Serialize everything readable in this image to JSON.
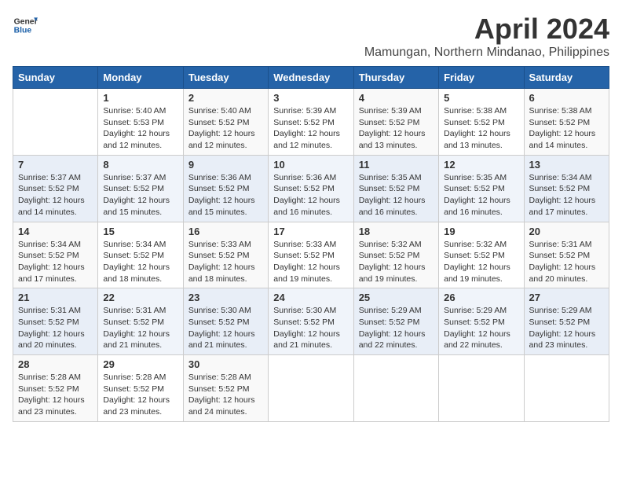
{
  "header": {
    "logo_line1": "General",
    "logo_line2": "Blue",
    "month_year": "April 2024",
    "location": "Mamungan, Northern Mindanao, Philippines"
  },
  "weekdays": [
    "Sunday",
    "Monday",
    "Tuesday",
    "Wednesday",
    "Thursday",
    "Friday",
    "Saturday"
  ],
  "weeks": [
    [
      {
        "day": "",
        "info": ""
      },
      {
        "day": "1",
        "info": "Sunrise: 5:40 AM\nSunset: 5:53 PM\nDaylight: 12 hours\nand 12 minutes."
      },
      {
        "day": "2",
        "info": "Sunrise: 5:40 AM\nSunset: 5:52 PM\nDaylight: 12 hours\nand 12 minutes."
      },
      {
        "day": "3",
        "info": "Sunrise: 5:39 AM\nSunset: 5:52 PM\nDaylight: 12 hours\nand 12 minutes."
      },
      {
        "day": "4",
        "info": "Sunrise: 5:39 AM\nSunset: 5:52 PM\nDaylight: 12 hours\nand 13 minutes."
      },
      {
        "day": "5",
        "info": "Sunrise: 5:38 AM\nSunset: 5:52 PM\nDaylight: 12 hours\nand 13 minutes."
      },
      {
        "day": "6",
        "info": "Sunrise: 5:38 AM\nSunset: 5:52 PM\nDaylight: 12 hours\nand 14 minutes."
      }
    ],
    [
      {
        "day": "7",
        "info": "Sunrise: 5:37 AM\nSunset: 5:52 PM\nDaylight: 12 hours\nand 14 minutes."
      },
      {
        "day": "8",
        "info": "Sunrise: 5:37 AM\nSunset: 5:52 PM\nDaylight: 12 hours\nand 15 minutes."
      },
      {
        "day": "9",
        "info": "Sunrise: 5:36 AM\nSunset: 5:52 PM\nDaylight: 12 hours\nand 15 minutes."
      },
      {
        "day": "10",
        "info": "Sunrise: 5:36 AM\nSunset: 5:52 PM\nDaylight: 12 hours\nand 16 minutes."
      },
      {
        "day": "11",
        "info": "Sunrise: 5:35 AM\nSunset: 5:52 PM\nDaylight: 12 hours\nand 16 minutes."
      },
      {
        "day": "12",
        "info": "Sunrise: 5:35 AM\nSunset: 5:52 PM\nDaylight: 12 hours\nand 16 minutes."
      },
      {
        "day": "13",
        "info": "Sunrise: 5:34 AM\nSunset: 5:52 PM\nDaylight: 12 hours\nand 17 minutes."
      }
    ],
    [
      {
        "day": "14",
        "info": "Sunrise: 5:34 AM\nSunset: 5:52 PM\nDaylight: 12 hours\nand 17 minutes."
      },
      {
        "day": "15",
        "info": "Sunrise: 5:34 AM\nSunset: 5:52 PM\nDaylight: 12 hours\nand 18 minutes."
      },
      {
        "day": "16",
        "info": "Sunrise: 5:33 AM\nSunset: 5:52 PM\nDaylight: 12 hours\nand 18 minutes."
      },
      {
        "day": "17",
        "info": "Sunrise: 5:33 AM\nSunset: 5:52 PM\nDaylight: 12 hours\nand 19 minutes."
      },
      {
        "day": "18",
        "info": "Sunrise: 5:32 AM\nSunset: 5:52 PM\nDaylight: 12 hours\nand 19 minutes."
      },
      {
        "day": "19",
        "info": "Sunrise: 5:32 AM\nSunset: 5:52 PM\nDaylight: 12 hours\nand 19 minutes."
      },
      {
        "day": "20",
        "info": "Sunrise: 5:31 AM\nSunset: 5:52 PM\nDaylight: 12 hours\nand 20 minutes."
      }
    ],
    [
      {
        "day": "21",
        "info": "Sunrise: 5:31 AM\nSunset: 5:52 PM\nDaylight: 12 hours\nand 20 minutes."
      },
      {
        "day": "22",
        "info": "Sunrise: 5:31 AM\nSunset: 5:52 PM\nDaylight: 12 hours\nand 21 minutes."
      },
      {
        "day": "23",
        "info": "Sunrise: 5:30 AM\nSunset: 5:52 PM\nDaylight: 12 hours\nand 21 minutes."
      },
      {
        "day": "24",
        "info": "Sunrise: 5:30 AM\nSunset: 5:52 PM\nDaylight: 12 hours\nand 21 minutes."
      },
      {
        "day": "25",
        "info": "Sunrise: 5:29 AM\nSunset: 5:52 PM\nDaylight: 12 hours\nand 22 minutes."
      },
      {
        "day": "26",
        "info": "Sunrise: 5:29 AM\nSunset: 5:52 PM\nDaylight: 12 hours\nand 22 minutes."
      },
      {
        "day": "27",
        "info": "Sunrise: 5:29 AM\nSunset: 5:52 PM\nDaylight: 12 hours\nand 23 minutes."
      }
    ],
    [
      {
        "day": "28",
        "info": "Sunrise: 5:28 AM\nSunset: 5:52 PM\nDaylight: 12 hours\nand 23 minutes."
      },
      {
        "day": "29",
        "info": "Sunrise: 5:28 AM\nSunset: 5:52 PM\nDaylight: 12 hours\nand 23 minutes."
      },
      {
        "day": "30",
        "info": "Sunrise: 5:28 AM\nSunset: 5:52 PM\nDaylight: 12 hours\nand 24 minutes."
      },
      {
        "day": "",
        "info": ""
      },
      {
        "day": "",
        "info": ""
      },
      {
        "day": "",
        "info": ""
      },
      {
        "day": "",
        "info": ""
      }
    ]
  ]
}
